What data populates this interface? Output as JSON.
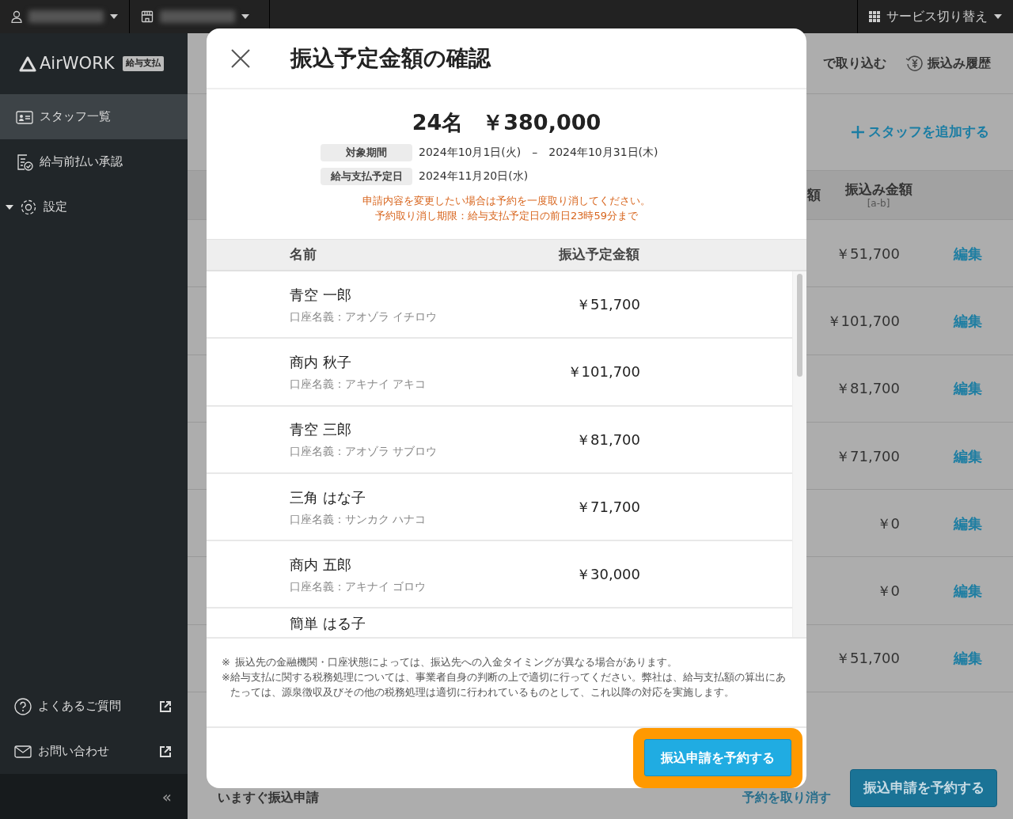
{
  "topbar": {
    "service_switch": {
      "label": "サービス切り替え",
      "expanded": false
    }
  },
  "sidebar": {
    "logo": {
      "name": "AirWORK",
      "badge": "給与支払"
    },
    "items": [
      {
        "label": "スタッフ一覧",
        "kind": "staff",
        "selected": true
      },
      {
        "label": "給与前払い承認",
        "kind": "approval",
        "selected": false
      },
      {
        "label": "設定",
        "kind": "settings",
        "selected": false,
        "expanded": true
      }
    ],
    "links": [
      {
        "label": "よくあるご質問",
        "kind": "help"
      },
      {
        "label": "お問い合わせ",
        "kind": "mail"
      }
    ],
    "collapse": "«"
  },
  "page": {
    "actions": [
      {
        "label": "で取り込む",
        "kind": "plain"
      },
      {
        "label": "振込み履歴",
        "kind": "history"
      }
    ],
    "add_staff": "スタッフを追加する",
    "columns": [
      {
        "label": "額"
      },
      {
        "label": "振込み金額",
        "note": "[a-b]"
      }
    ],
    "rows": [
      {
        "amount": "￥51,700",
        "action": "編集"
      },
      {
        "amount": "￥101,700",
        "action": "編集"
      },
      {
        "amount": "￥81,700",
        "action": "編集"
      },
      {
        "amount": "￥71,700",
        "action": "編集"
      },
      {
        "amount": "￥0",
        "action": "編集"
      },
      {
        "amount": "￥0",
        "action": "編集"
      },
      {
        "amount": "￥51,700",
        "action": "編集"
      }
    ],
    "instant_transfer": "いますぐ振込申請",
    "cancel": "予約を取り消す",
    "submit": "振込申請を予約する"
  },
  "modal": {
    "title": "振込予定金額の確認",
    "count": "24名",
    "total": "￥380,000",
    "info": [
      {
        "label": "対象期間",
        "value": "2024年10月1日(火)　–　2024年10月31日(木)"
      },
      {
        "label": "給与支払予定日",
        "value": "2024年11月20日(水)"
      }
    ],
    "warnings": [
      "申請内容を変更したい場合は予約を一度取り消してください。",
      "予約取り消し期限：給与支払予定日の前日23時59分まで"
    ],
    "columns": [
      "名前",
      "振込予定金額"
    ],
    "rows": [
      {
        "name": "青空 一郎",
        "account": "口座名義：アオゾラ イチロウ",
        "amount": "￥51,700"
      },
      {
        "name": "商内 秋子",
        "account": "口座名義：アキナイ アキコ",
        "amount": "￥101,700"
      },
      {
        "name": "青空 三郎",
        "account": "口座名義：アオゾラ サブロウ",
        "amount": "￥81,700"
      },
      {
        "name": "三角 はな子",
        "account": "口座名義：サンカク ハナコ",
        "amount": "￥71,700"
      },
      {
        "name": "商内 五郎",
        "account": "口座名義：アキナイ ゴロウ",
        "amount": "￥30,000"
      },
      {
        "name": "簡単 はる子"
      }
    ],
    "notes": [
      "振込先の金融機関・口座状態によっては、振込先への入金タイミングが異なる場合があります。",
      "給与支払に関する税務処理については、事業者自身の判断の上で適切に行ってください。弊社は、給与支払額の算出にあたっては、源泉徴収及びその他の税務処理は適切に行われているものとして、これ以降の対応を実施します。"
    ],
    "note_mark": "※",
    "submit": {
      "label": "振込申請を予約する",
      "highlighted": true
    }
  }
}
